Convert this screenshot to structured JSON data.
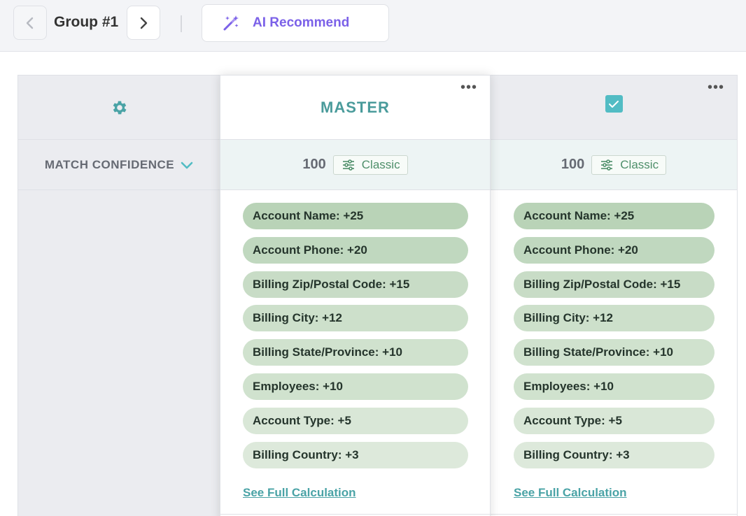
{
  "toolbar": {
    "group_title": "Group #1",
    "ai_recommend_label": "AI Recommend",
    "accent_color": "#7b61e8"
  },
  "grid": {
    "left": {
      "match_confidence_label": "MATCH CONFIDENCE"
    },
    "master": {
      "title": "MASTER",
      "score": "100",
      "scoring_mode": "Classic",
      "pills": [
        {
          "label": "Account Name: +25",
          "color": "#b9d3b7"
        },
        {
          "label": "Account Phone: +20",
          "color": "#c0d8bf"
        },
        {
          "label": "Billing Zip/Postal Code: +15",
          "color": "#c8dcc6"
        },
        {
          "label": "Billing City: +12",
          "color": "#cde0cb"
        },
        {
          "label": "Billing State/Province: +10",
          "color": "#d0e2ce"
        },
        {
          "label": "Employees: +10",
          "color": "#d0e2ce"
        },
        {
          "label": "Account Type: +5",
          "color": "#d9e7d7"
        },
        {
          "label": "Billing Country: +3",
          "color": "#dde9db"
        }
      ],
      "see_full_label": "See Full Calculation"
    },
    "record": {
      "selected": true,
      "score": "100",
      "scoring_mode": "Classic",
      "pills": [
        {
          "label": "Account Name: +25",
          "color": "#b9d3b7"
        },
        {
          "label": "Account Phone: +20",
          "color": "#c0d8bf"
        },
        {
          "label": "Billing Zip/Postal Code: +15",
          "color": "#c8dcc6"
        },
        {
          "label": "Billing City: +12",
          "color": "#cde0cb"
        },
        {
          "label": "Billing State/Province: +10",
          "color": "#d0e2ce"
        },
        {
          "label": "Employees: +10",
          "color": "#d0e2ce"
        },
        {
          "label": "Account Type: +5",
          "color": "#d9e7d7"
        },
        {
          "label": "Billing Country: +3",
          "color": "#dde9db"
        }
      ],
      "see_full_label": "See Full Calculation"
    }
  },
  "icons": {
    "prev": "chevron-left-icon",
    "next": "chevron-right-icon",
    "ai": "magic-wand-icon",
    "settings": "gear-icon",
    "sort": "chevron-down-icon",
    "more": "more-horizontal-icon",
    "classic": "sliders-icon",
    "checkbox": "check-icon"
  }
}
